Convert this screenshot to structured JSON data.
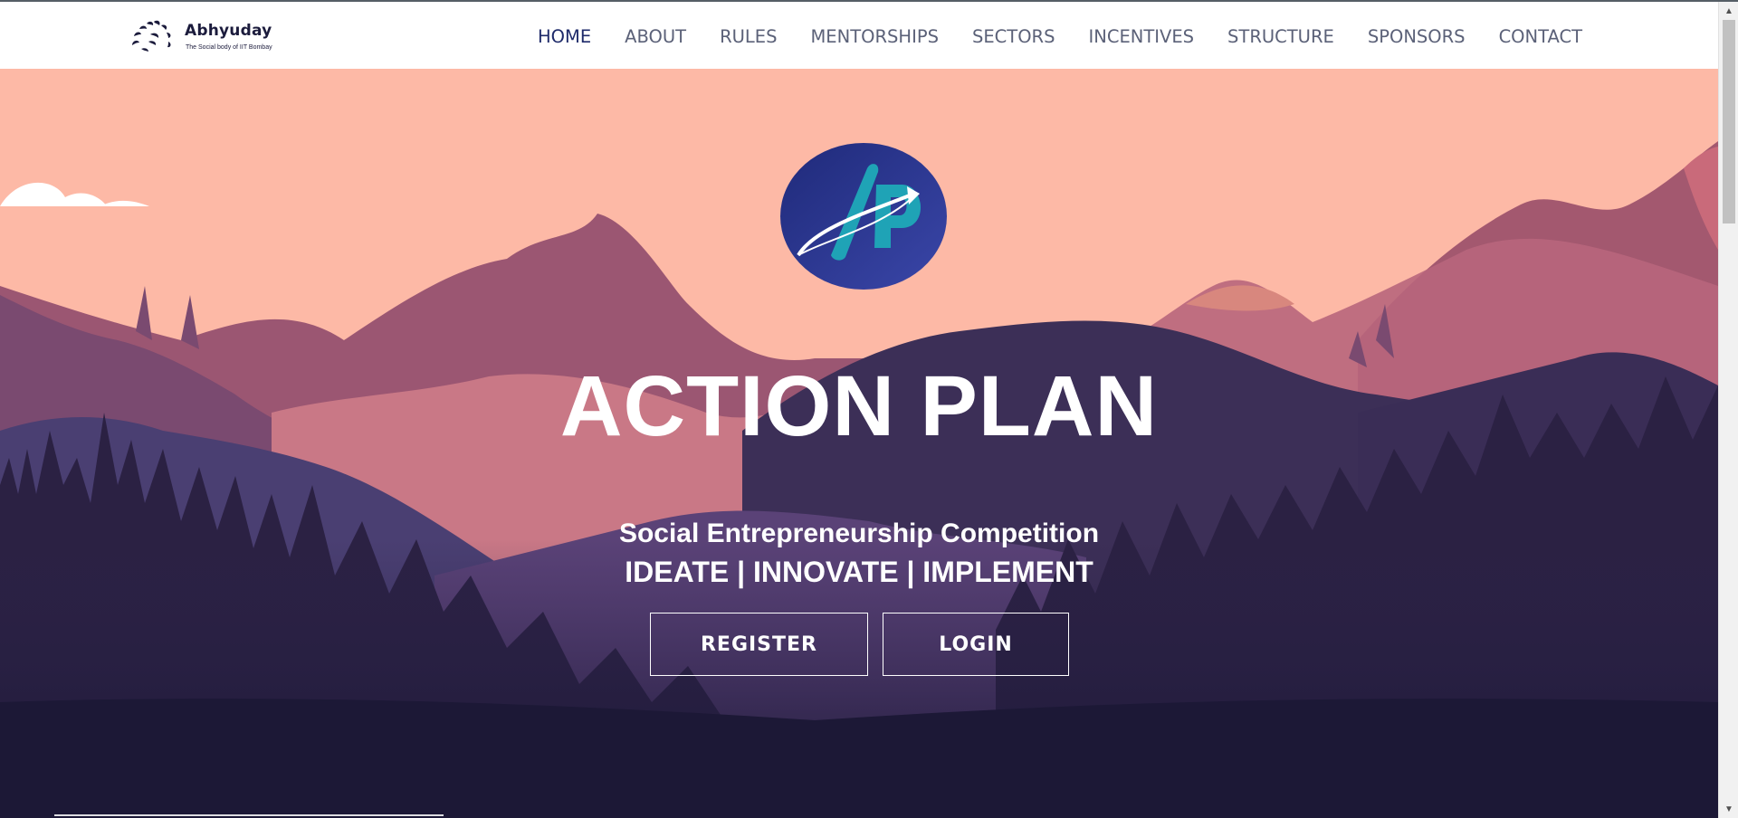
{
  "brand": {
    "name": "Abhyuday",
    "tagline": "The Social body of IIT Bombay"
  },
  "nav": {
    "items": [
      {
        "label": "HOME",
        "active": true
      },
      {
        "label": "ABOUT"
      },
      {
        "label": "RULES"
      },
      {
        "label": "MENTORSHIPS"
      },
      {
        "label": "SECTORS"
      },
      {
        "label": "INCENTIVES"
      },
      {
        "label": "STRUCTURE"
      },
      {
        "label": "SPONSORS"
      },
      {
        "label": "CONTACT"
      }
    ]
  },
  "hero": {
    "logo_icon": "action-plan-logo",
    "title": "ACTION PLAN",
    "subtitle": "Social Entrepreneurship Competition",
    "tagline": "IDEATE | INNOVATE | IMPLEMENT",
    "register_label": "REGISTER",
    "login_label": "LOGIN"
  },
  "colors": {
    "sky": "#fdb9a6",
    "nav_active": "#1e2a6a",
    "nav_text": "#5b6178",
    "logo_bg": "#2b318d",
    "logo_teal": "#1fa3b6"
  }
}
